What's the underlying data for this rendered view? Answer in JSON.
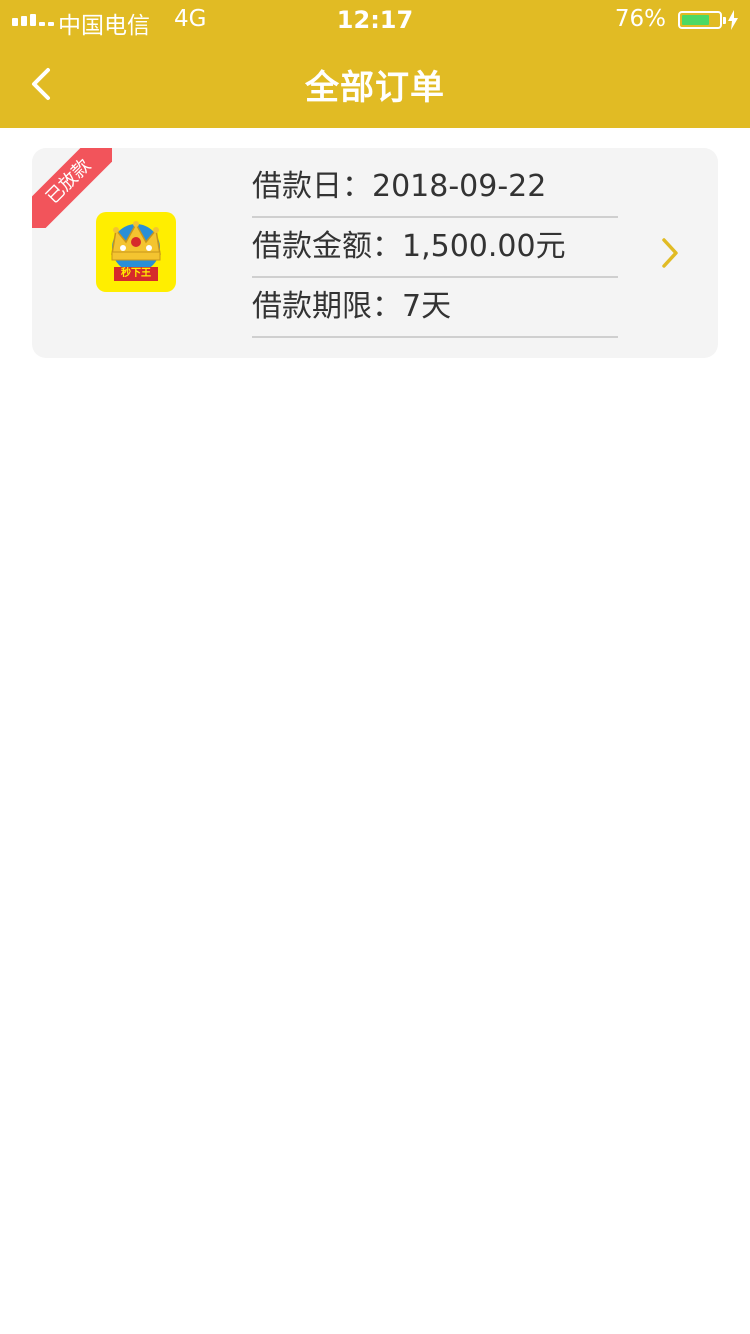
{
  "statusbar": {
    "carrier": "中国电信",
    "network": "4G",
    "time": "12:17",
    "battery_percent": "76%",
    "battery_level": 0.76,
    "battery_fill_color": "#4cd964"
  },
  "navbar": {
    "title": "全部订单",
    "background_color": "#e1bb24",
    "back_icon": "chevron-left-icon"
  },
  "order": {
    "status_badge": "已放款",
    "status_badge_color": "#f2545b",
    "logo_text": "秒下王",
    "rows": [
      {
        "label": "借款日：",
        "value": "2018-09-22"
      },
      {
        "label": "借款金额：",
        "value": "1,500.00元"
      },
      {
        "label": "借款期限：",
        "value": "7天"
      }
    ],
    "arrow_icon": "chevron-right-icon",
    "arrow_color": "#e1bb24"
  }
}
